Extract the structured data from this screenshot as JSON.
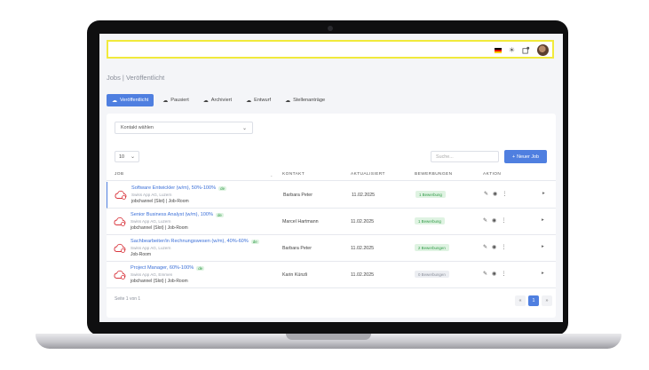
{
  "header": {
    "flag_colors": [
      "#000000",
      "#dd0000",
      "#ffce00"
    ],
    "icons": [
      "flag-de-icon",
      "sun-icon",
      "notification-icon",
      "avatar"
    ]
  },
  "page": {
    "title_prefix": "Jobs | ",
    "title_main": "Veröffentlicht"
  },
  "tabs": [
    {
      "label": "Veröffentlicht",
      "active": true
    },
    {
      "label": "Pausiert",
      "active": false
    },
    {
      "label": "Archiviert",
      "active": false
    },
    {
      "label": "Entwurf",
      "active": false
    },
    {
      "label": "Stellenanträge",
      "active": false
    }
  ],
  "filters": {
    "contact_select": "Kontakt wählen",
    "per_page": "10",
    "search_placeholder": "Suche...",
    "new_job_label": "Neuer Job"
  },
  "table": {
    "columns": [
      "JOB",
      "KONTAKT",
      "AKTUALISIERT",
      "BEWERBUNGEN",
      "AKTION"
    ],
    "rows": [
      {
        "title": "Software Entwickler (w/m), 50%-100%",
        "lang": "de",
        "company": "Swiss App AG, Luzern",
        "channel": "jobchannel (Slot) | Job-Room",
        "contact": "Barbara Peter",
        "updated": "11.02.2025",
        "applications": "1 Bewerbung",
        "has_apps": true
      },
      {
        "title": "Senior Business Analyst (w/m), 100%",
        "lang": "de",
        "company": "Swiss App AG, Luzern",
        "channel": "jobchannel (Slot) | Job-Room",
        "contact": "Marcel Hartmann",
        "updated": "11.02.2025",
        "applications": "1 Bewerbung",
        "has_apps": true
      },
      {
        "title": "Sachbearbeiter/in Rechnungswesen (w/m), 40%-60%",
        "lang": "de",
        "company": "Swiss App AG, Luzern",
        "channel": "Job-Room",
        "contact": "Barbara Peter",
        "updated": "11.02.2025",
        "applications": "2 Bewerbungen",
        "has_apps": true
      },
      {
        "title": "Project Manager, 60%-100%",
        "lang": "de",
        "company": "Swiss App AG, Emmen",
        "channel": "jobchannel (Slot) | Job-Room",
        "contact": "Karin Künzli",
        "updated": "11.02.2025",
        "applications": "0 Bewerbungen",
        "has_apps": false
      }
    ]
  },
  "pagination": {
    "summary": "Seite 1 von 1",
    "prev": "«",
    "current": "1",
    "next": "»"
  },
  "colors": {
    "accent": "#4f7fe0",
    "topbar_border": "#f1ea3b",
    "job_icon": "#d9363e",
    "badge_green": "#2f9a46"
  }
}
